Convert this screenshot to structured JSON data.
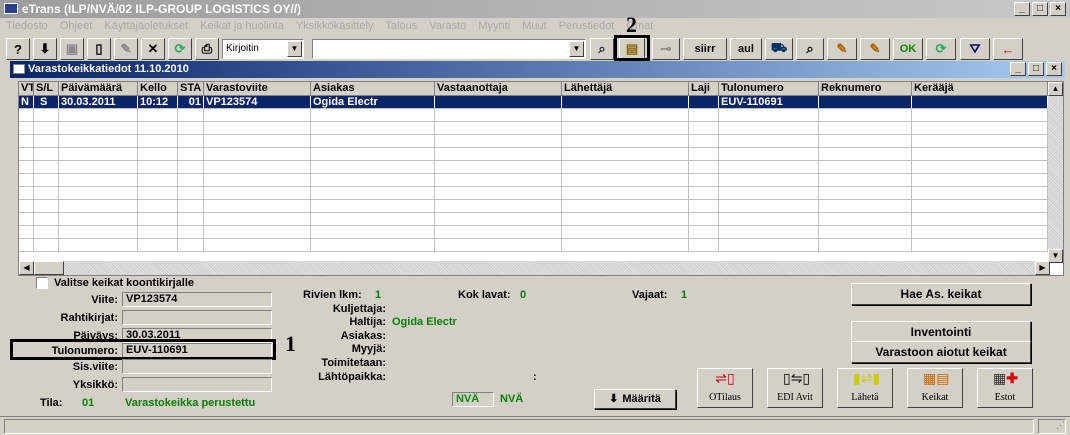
{
  "window": {
    "title": "eTrans  (ILP/NVÄ/02 ILP-GROUP LOGISTICS OY//)"
  },
  "menu": [
    "Tiedosto",
    "Ohjeet",
    "Käyttäjäoletukset",
    "Keikat ja huolinta",
    "Yksikkökäsittely",
    "Talous",
    "Varasto",
    "Myynti",
    "Muut",
    "Perustiedot",
    "Omat"
  ],
  "toolbar": {
    "printer": "Kirjoitin",
    "search_text": "",
    "btn_siirr": "siirr",
    "btn_aul": "aul",
    "btn_ok": "OK"
  },
  "annotations": {
    "one": "1",
    "two": "2"
  },
  "child": {
    "title": "Varastokeikkatiedot 11.10.2010"
  },
  "grid": {
    "headers": [
      "VT",
      "S/L",
      "Päivämäärä",
      "Kello",
      "STA",
      "Varastoviite",
      "Asiakas",
      "Vastaanottaja",
      "Lähettäjä",
      "Laji",
      "Tulonumero",
      "Reknumero",
      "Kerääjä"
    ],
    "rows": [
      [
        "N",
        "S",
        "30.03.2011",
        "10:12",
        "01",
        "VP123574",
        "Ogida Electr",
        "",
        "",
        "",
        "EUV-110691",
        "",
        ""
      ]
    ]
  },
  "form": {
    "checkbox_label": "Valitse keikat koontikirjalle",
    "viite_label": "Viite:",
    "viite_value": "VP123574",
    "rahtikirjat_label": "Rahtikirjat:",
    "rahtikirjat_value": "",
    "paivays_label": "Päiväys:",
    "paivays_value": "30.03.2011",
    "tulonumero_label": "Tulonumero:",
    "tulonumero_value": "EUV-110691",
    "sisviite_label": "Sis.viite:",
    "sisviite_value": "",
    "yksikko_label": "Yksikkö:",
    "yksikko_value": "",
    "tila_label": "Tila:",
    "tila_code": "01",
    "tila_text": "Varastokeikka perustettu"
  },
  "info": {
    "rivien_label": "Rivien lkm:",
    "rivien_value": "1",
    "kok_label": "Kok lavat:",
    "kok_value": "0",
    "vajaat_label": "Vajaat:",
    "vajaat_value": "1",
    "kuljettaja_label": "Kuljettaja:",
    "haltija_label": "Haltija:",
    "haltija_value": "Ogida Electr",
    "asiakas_label": "Asiakas:",
    "myyja_label": "Myyjä:",
    "toimitetaan_label": "Toimitetaan:",
    "lahtopaikka_label": "Lähtöpaikka:",
    "colon": ":"
  },
  "buttons": {
    "hae": "Hae As. keikat",
    "inventointi": "Inventointi",
    "varastoon": "Varastoon aiotut keikat",
    "nva1": "NVÄ",
    "nva2": "NVÄ",
    "maarita": "Määritä",
    "otilaus": "OTilaus",
    "edi": "EDI Avit",
    "laheta": "Lähetä",
    "keikat": "Keikat",
    "estot": "Estot"
  }
}
